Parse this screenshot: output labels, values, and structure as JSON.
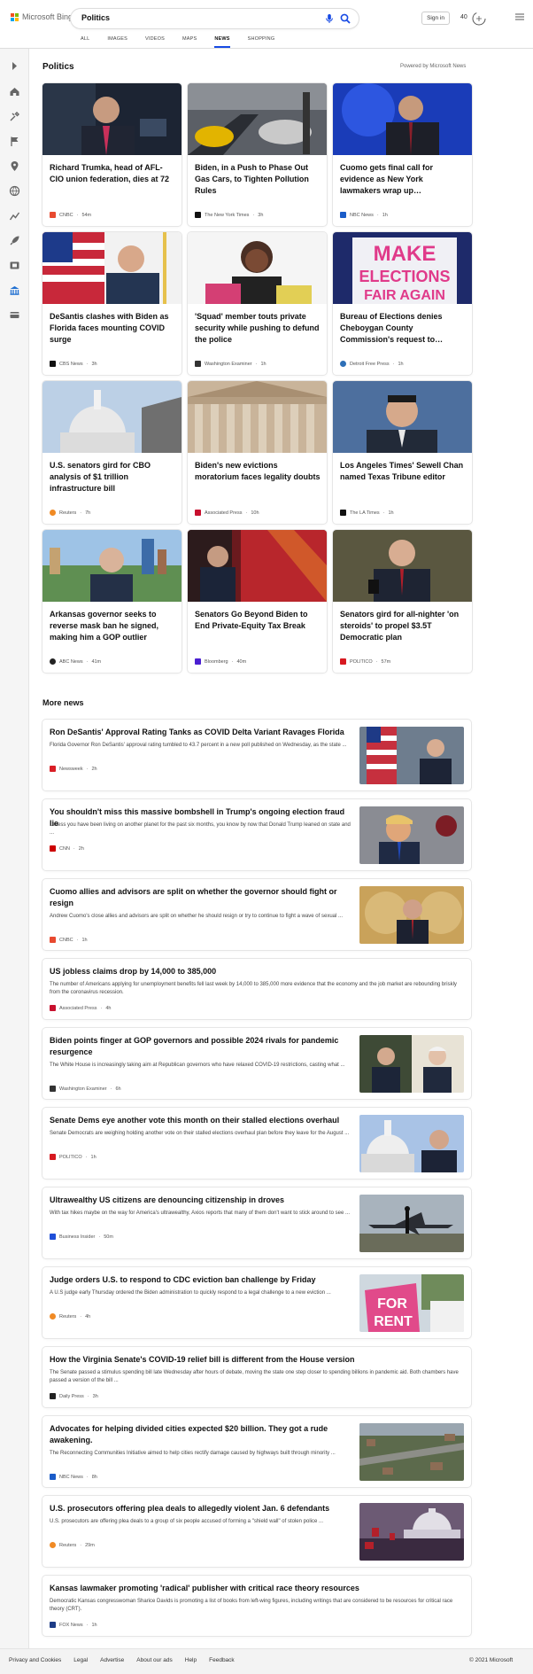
{
  "header": {
    "brand": "Microsoft Bing",
    "query": "Politics",
    "sign_in": "Sign in",
    "points": "40",
    "scopes": [
      "ALL",
      "IMAGES",
      "VIDEOS",
      "MAPS",
      "NEWS",
      "SHOPPING"
    ],
    "active_scope": "NEWS"
  },
  "sidebar": {
    "icons": [
      "chevron-right-icon",
      "home-icon",
      "tools-icon",
      "flag-icon",
      "location-icon",
      "globe-icon",
      "chart-icon",
      "rocket-icon",
      "film-icon",
      "bank-icon",
      "card-icon"
    ]
  },
  "section": {
    "title": "Politics",
    "powered": "Powered by Microsoft News"
  },
  "cards": [
    {
      "title": "Richard Trumka, head of AFL-CIO union federation, dies at 72",
      "source": "CNBC",
      "time": "54m",
      "color": "#e84a30"
    },
    {
      "title": "Biden, in a Push to Phase Out Gas Cars, to Tighten Pollution Rules",
      "source": "The New York Times",
      "time": "3h",
      "color": "#111111"
    },
    {
      "title": "Cuomo gets final call for evidence as New York lawmakers wrap up…",
      "source": "NBC News",
      "time": "1h",
      "color": "#1a5cc8"
    },
    {
      "title": "DeSantis clashes with Biden as Florida faces mounting COVID surge",
      "source": "CBS News",
      "time": "3h",
      "color": "#111111"
    },
    {
      "title": "'Squad' member touts private security while pushing to defund the police",
      "source": "Washington Examiner",
      "time": "1h",
      "color": "#333333"
    },
    {
      "title": "Bureau of Elections denies Cheboygan County Commission's request to…",
      "source": "Detroit Free Press",
      "time": "1h",
      "color": "#2d6fb7"
    },
    {
      "title": "U.S. senators gird for CBO analysis of $1 trillion infrastructure bill",
      "source": "Reuters",
      "time": "7h",
      "color": "#f08a24"
    },
    {
      "title": "Biden's new evictions moratorium faces legality doubts",
      "source": "Associated Press",
      "time": "10h",
      "color": "#c8102e"
    },
    {
      "title": "Los Angeles Times' Sewell Chan named Texas Tribune editor",
      "source": "The LA Times",
      "time": "1h",
      "color": "#111111"
    },
    {
      "title": "Arkansas governor seeks to reverse mask ban he signed, making him a GOP outlier",
      "source": "ABC News",
      "time": "41m",
      "color": "#222222"
    },
    {
      "title": "Senators Go Beyond Biden to End Private-Equity Tax Break",
      "source": "Bloomberg",
      "time": "40m",
      "color": "#4b1fd1"
    },
    {
      "title": "Senators gird for all-nighter 'on steroids' to propel $3.5T Democratic plan",
      "source": "POLITICO",
      "time": "57m",
      "color": "#d71920"
    }
  ],
  "more_news": {
    "title": "More news",
    "items": [
      {
        "title": "Ron DeSantis' Approval Rating Tanks as COVID Delta Variant Ravages Florida",
        "snippet": "Florida Governor Ron DeSantis' approval rating tumbled to 43.7 percent in a new poll published on Wednesday, as the state ...",
        "source": "Newsweek",
        "time": "2h",
        "color": "#d91f26",
        "has_image": true
      },
      {
        "title": "You shouldn't miss this massive bombshell in Trump's ongoing election fraud lie",
        "snippet": "Unless you have been living on another planet for the past six months, you know by now that Donald Trump leaned on state and ...",
        "source": "CNN",
        "time": "2h",
        "color": "#cc0000",
        "has_image": true
      },
      {
        "title": "Cuomo allies and advisors are split on whether the governor should fight or resign",
        "snippet": "Andrew Cuomo's close allies and advisors are split on whether he should resign or try to continue to fight a wave of sexual ...",
        "source": "CNBC",
        "time": "1h",
        "color": "#e84a30",
        "has_image": true
      },
      {
        "title": "US jobless claims drop by 14,000 to 385,000",
        "snippet": "The number of Americans applying for unemployment benefits fell last week by 14,000 to 385,000 more evidence that the economy and the job market are rebounding briskly from the coronavirus recession.",
        "source": "Associated Press",
        "time": "4h",
        "color": "#c8102e",
        "has_image": false
      },
      {
        "title": "Biden points finger at GOP governors and possible 2024 rivals for pandemic resurgence",
        "snippet": "The White House is increasingly taking aim at Republican governors who have relaxed COVID-19 restrictions, casting what ...",
        "source": "Washington Examiner",
        "time": "6h",
        "color": "#333333",
        "has_image": true
      },
      {
        "title": "Senate Dems eye another vote this month on their stalled elections overhaul",
        "snippet": "Senate Democrats are weighing holding another vote on their stalled elections overhaul plan before they leave for the August ...",
        "source": "POLITICO",
        "time": "1h",
        "color": "#d71920",
        "has_image": true
      },
      {
        "title": "Ultrawealthy US citizens are denouncing citizenship in droves",
        "snippet": "With tax hikes maybe on the way for America's ultrawealthy, Axios reports that many of them don't want to stick around to see ...",
        "source": "Business Insider",
        "time": "50m",
        "color": "#1f4fd8",
        "has_image": true
      },
      {
        "title": "Judge orders U.S. to respond to CDC eviction ban challenge by Friday",
        "snippet": "A U.S judge early Thursday ordered the Biden administration to quickly respond to a legal challenge to a new eviction ...",
        "source": "Reuters",
        "time": "4h",
        "color": "#f08a24",
        "has_image": true
      },
      {
        "title": "How the Virginia Senate's COVID-19 relief bill is different from the House version",
        "snippet": "The Senate passed a stimulus spending bill late Wednesday after hours of debate, moving the state one step closer to spending billions in pandemic aid. Both chambers have passed a version of the bill ...",
        "source": "Daily Press",
        "time": "3h",
        "color": "#222222",
        "has_image": false
      },
      {
        "title": "Advocates for helping divided cities expected $20 billion. They got a rude awakening.",
        "snippet": "The Reconnecting Communities Initiative aimed to help cities rectify damage caused by highways built through minority ...",
        "source": "NBC News",
        "time": "8h",
        "color": "#1a5cc8",
        "has_image": true
      },
      {
        "title": "U.S. prosecutors offering plea deals to allegedly violent Jan. 6 defendants",
        "snippet": "U.S. prosecutors are offering plea deals to a group of six people accused of forming a \"shield wall\" of stolen police ...",
        "source": "Reuters",
        "time": "29m",
        "color": "#f08a24",
        "has_image": true
      },
      {
        "title": "Kansas lawmaker promoting 'radical' publisher with critical race theory resources",
        "snippet": "Democratic Kansas congresswoman Sharice Davids is promoting a list of books from left-wing figures, including writings that are considered to be resources for critical race theory (CRT).",
        "source": "FOX News",
        "time": "1h",
        "color": "#1d3c86",
        "has_image": false
      }
    ]
  },
  "footer": {
    "links": [
      "Privacy and Cookies",
      "Legal",
      "Advertise",
      "About our ads",
      "Help",
      "Feedback"
    ],
    "copyright": "© 2021 Microsoft"
  }
}
